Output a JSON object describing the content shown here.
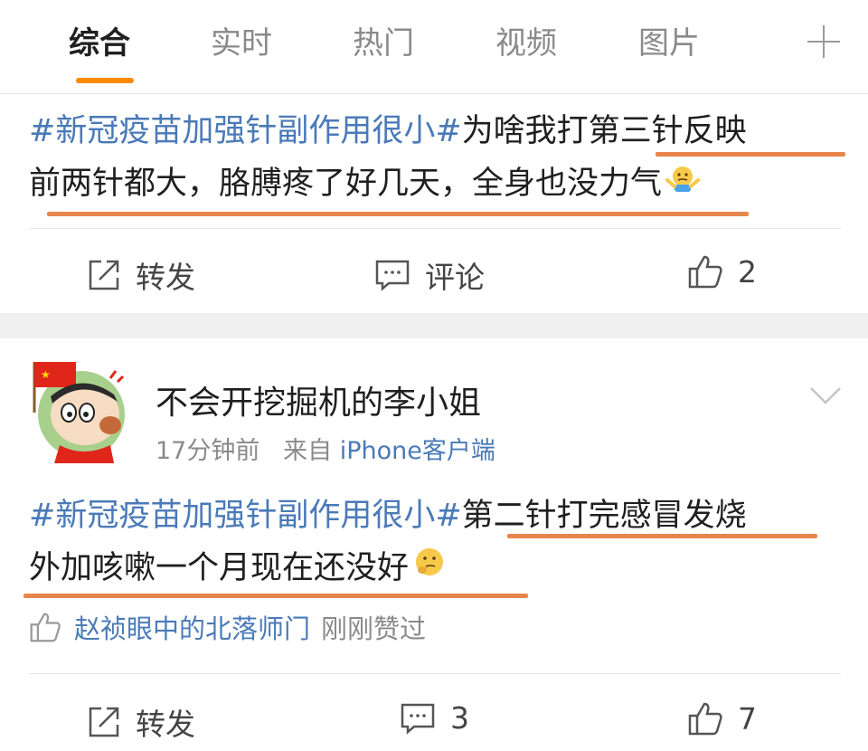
{
  "tabs": [
    {
      "label": "综合",
      "active": true
    },
    {
      "label": "实时",
      "active": false
    },
    {
      "label": "热门",
      "active": false
    },
    {
      "label": "视频",
      "active": false
    },
    {
      "label": "图片",
      "active": false
    }
  ],
  "add_tab_icon": "plus-icon",
  "colors": {
    "accent": "#ff8a00",
    "link": "#4a7ab8",
    "highlight_underline": "#e8854a"
  },
  "post1": {
    "hashtag": "#新冠疫苗加强针副作用很小#",
    "text_line1_rest": "为啥我打第三针反映",
    "text_line2": "前两针都大，胳膊疼了好几天，全身也没力气",
    "emoji": "shrug-emoji",
    "actions": {
      "repost": "转发",
      "comment": "评论",
      "like_count": "2"
    }
  },
  "post2": {
    "username": "不会开挖掘机的李小姐",
    "time": "17分钟前",
    "from_label": "来自",
    "source": "iPhone客户端",
    "hashtag": "#新冠疫苗加强针副作用很小#",
    "text_line1_rest": "第二针打完感冒发烧",
    "text_line2": "外加咳嗽一个月现在还没好",
    "emoji": "thinking-emoji",
    "liked_by": "赵祯眼中的北落师门",
    "liked_text": "刚刚赞过",
    "actions": {
      "repost": "转发",
      "comment_count": "3",
      "like_count": "7"
    }
  }
}
